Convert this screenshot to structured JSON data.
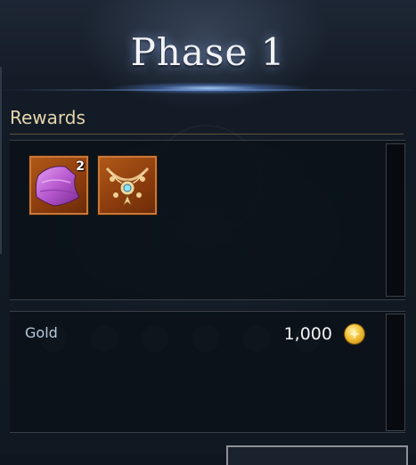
{
  "window": {
    "title": "Phase 1"
  },
  "rewards": {
    "header": "Rewards",
    "items": [
      {
        "icon": "purple-cloth-icon",
        "count": "2"
      },
      {
        "icon": "ornate-necklace-icon",
        "count": ""
      }
    ]
  },
  "gold": {
    "label": "Gold",
    "value": "1,000",
    "icon": "gold-coin-icon"
  },
  "colors": {
    "title": "#f2f3f7",
    "header": "#e6d6ad",
    "slot_bg": "#b35a18",
    "gold_label": "#b8c9dc",
    "coin": "#f2c037"
  }
}
